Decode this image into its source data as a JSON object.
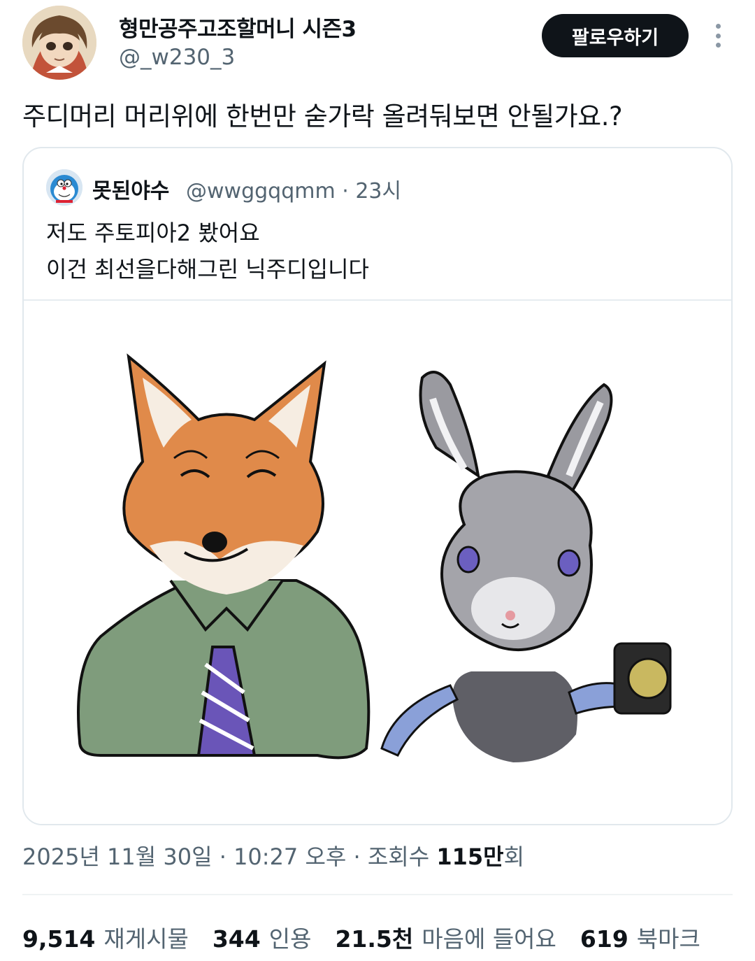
{
  "author": {
    "display_name": "형만공주고조할머니 시즌3",
    "handle": "@_w230_3",
    "avatar_icon": "anime-girl-avatar"
  },
  "follow_label": "팔로우하기",
  "more_icon": "more-options-icon",
  "tweet_text": "주디머리 머리위에 한번만 숟가락 올려둬보면 안될가요.?",
  "quote": {
    "display_name": "못된야수",
    "handle": "@wwggqqmm",
    "time": "23시",
    "lines": [
      "저도 주토피아2 봤어요",
      "이건 최선을다해그린 닉주디입니다"
    ],
    "image_icon": "fox-and-rabbit-drawing"
  },
  "timestamp": {
    "date": "2025년 11월 30일",
    "time": "10:27 오후",
    "views_label": "조회수",
    "views_num": "115만",
    "views_suffix": "회"
  },
  "stats": [
    {
      "num": "9,514",
      "label": "재게시물"
    },
    {
      "num": "344",
      "label": "인용"
    },
    {
      "num": "21.5천",
      "label": "마음에 들어요"
    },
    {
      "num": "619",
      "label": "북마크"
    }
  ],
  "colors": {
    "text_primary": "#0f1419",
    "text_secondary": "#536471",
    "border": "#e1e8ed"
  }
}
